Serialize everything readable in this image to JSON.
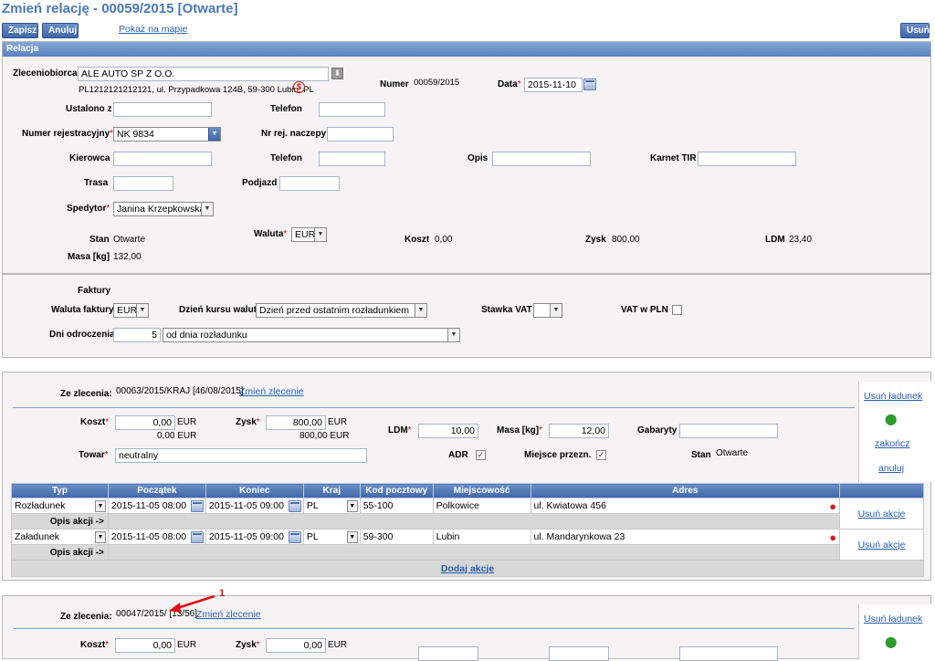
{
  "page": {
    "title": "Zmień relację - 00059/2015 [Otwarte]"
  },
  "toolbar": {
    "save": "Zapisz",
    "cancel": "Anuluj",
    "show_map": "Pokaż na mapie",
    "delete": "Usuń"
  },
  "relacja": {
    "header": "Relacja",
    "zleceniobiorca_label": "Zleceniobiorca",
    "zleceniobiorca_value": "ALE AUTO SP Z O.O.",
    "address": "PL1212121212121, ul. Przypadkowa 124B, 59-300 Lubin, PL",
    "numer_label": "Numer",
    "numer_value": "00059/2015",
    "data_label": "Data",
    "data_value": "2015-11-10",
    "ustalono_label": "Ustalono z",
    "telefon_label": "Telefon",
    "nr_rej_label": "Numer rejestracyjny",
    "nr_rej_value": "NK 9834",
    "nr_rej_naczepy_label": "Nr rej. naczepy",
    "kierowca_label": "Kierowca",
    "telefon2_label": "Telefon",
    "opis_label": "Opis",
    "karnet_label": "Karnet TIR",
    "trasa_label": "Trasa",
    "podjazd_label": "Podjazd",
    "spedytor_label": "Spedytor",
    "spedytor_value": "Janina Krzepkowska",
    "stan_label": "Stan",
    "stan_value": "Otwarte",
    "waluta_label": "Waluta",
    "waluta_value": "EUR",
    "koszt_label": "Koszt",
    "koszt_value": "0,00",
    "zysk_label": "Zysk",
    "zysk_value": "800,00",
    "ldm_label": "LDM",
    "ldm_value": "23,40",
    "masa_label": "Masa [kg]",
    "masa_value": "132,00"
  },
  "faktury": {
    "header": "Faktury",
    "waluta_label": "Waluta faktury",
    "waluta_value": "EUR",
    "dzien_kursu_label": "Dzień kursu walut",
    "dzien_kursu_value": "Dzień przed ostatnim rozładunkiem",
    "stawka_vat_label": "Stawka VAT",
    "stawka_vat_value": "",
    "vat_pln_label": "VAT w PLN",
    "dni_label": "Dni odroczenia",
    "dni_value": "5",
    "od_value": "od dnia rozładunku"
  },
  "order1": {
    "ze_zlecenia_label": "Ze zlecenia:",
    "ze_zlecenia_value": "00063/2015/KRAJ [46/08/2015]",
    "zmien_link": "Zmień zlecenie",
    "usun_ladunek": "Usuń ładunek",
    "zakoncz": "zakończ",
    "anuluj": "anuluj",
    "koszt_label": "Koszt",
    "koszt_value": "0,00",
    "koszt_cur": "EUR",
    "koszt_sub": "0,00 EUR",
    "zysk_label": "Zysk",
    "zysk_value": "800,00",
    "zysk_cur": "EUR",
    "zysk_sub": "800,00 EUR",
    "ldm_label": "LDM",
    "ldm_value": "10,00",
    "masa_label": "Masa [kg]",
    "masa_value": "12,00",
    "gabaryty_label": "Gabaryty",
    "towar_label": "Towar",
    "towar_value": "neutralny",
    "adr_label": "ADR",
    "miejsce_label": "Miejsce przezn.",
    "stan_label": "Stan",
    "stan_value": "Otwarte",
    "columns": [
      "Typ",
      "Początek",
      "Koniec",
      "Kraj",
      "Kod pocztowy",
      "Miejscowość",
      "Adres"
    ],
    "rows": [
      {
        "typ": "Rozładunek",
        "start": "2015-11-05 08:00",
        "end": "2015-11-05 09:00",
        "kraj": "PL",
        "kod": "55-100",
        "miasto": "Polkowice",
        "adres": "ul. Kwiatowa 456",
        "action": "Usuń akcje",
        "opis": "Opis akcji ->"
      },
      {
        "typ": "Załadunek",
        "start": "2015-11-05 08:00",
        "end": "2015-11-05 09:00",
        "kraj": "PL",
        "kod": "59-300",
        "miasto": "Lubin",
        "adres": "ul. Mandarynkowa 23",
        "action": "Usuń akcje",
        "opis": "Opis akcji ->"
      }
    ],
    "dodaj_akcje": "Dodaj akcje"
  },
  "order2": {
    "ze_zlecenia_label": "Ze zlecenia:",
    "ze_zlecenia_value": "00047/2015/ [13/56]",
    "zmien_link": "Zmień zlecenie",
    "usun_ladunek": "Usuń ładunek",
    "koszt_label": "Koszt",
    "koszt_value": "0,00",
    "koszt_cur": "EUR",
    "zysk_label": "Zysk",
    "zysk_value": "0,00",
    "zysk_cur": "EUR"
  },
  "annotation": {
    "number": "1",
    "color": "#e01010"
  }
}
